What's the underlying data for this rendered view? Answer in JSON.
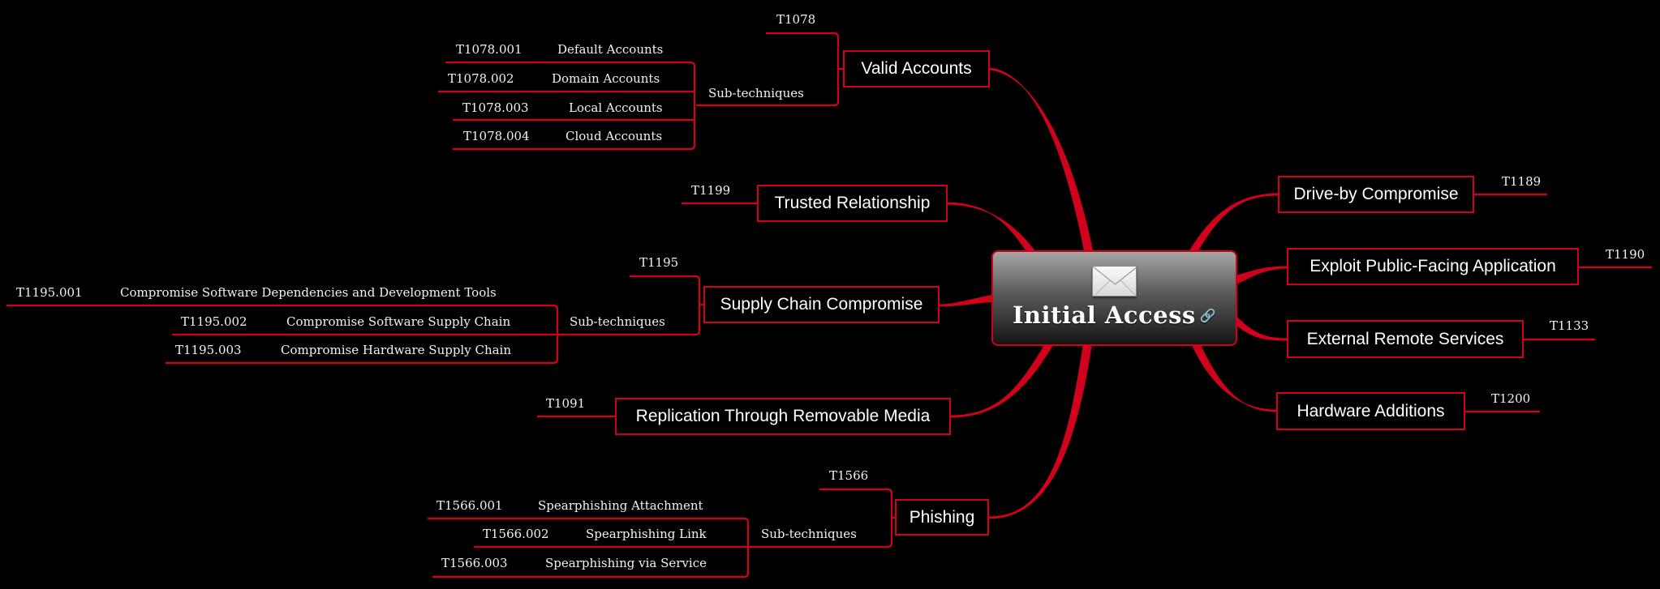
{
  "central": {
    "title": "Initial Access",
    "icon": "envelope-icon",
    "link_icon": "link-icon"
  },
  "colors": {
    "accent": "#d0021b",
    "background": "#000000",
    "link": "#2d7be0"
  },
  "techniques": [
    {
      "name": "Valid Accounts",
      "id": "T1078",
      "side": "left",
      "subtechniques_label": "Sub-techniques",
      "subtechniques": [
        {
          "id": "T1078.001",
          "name": "Default Accounts"
        },
        {
          "id": "T1078.002",
          "name": "Domain Accounts"
        },
        {
          "id": "T1078.003",
          "name": "Local Accounts"
        },
        {
          "id": "T1078.004",
          "name": "Cloud Accounts"
        }
      ]
    },
    {
      "name": "Trusted Relationship",
      "id": "T1199",
      "side": "left"
    },
    {
      "name": "Supply Chain Compromise",
      "id": "T1195",
      "side": "left",
      "subtechniques_label": "Sub-techniques",
      "subtechniques": [
        {
          "id": "T1195.001",
          "name": "Compromise Software Dependencies and Development Tools"
        },
        {
          "id": "T1195.002",
          "name": "Compromise Software Supply Chain"
        },
        {
          "id": "T1195.003",
          "name": "Compromise Hardware Supply Chain"
        }
      ]
    },
    {
      "name": "Replication Through Removable Media",
      "id": "T1091",
      "side": "left"
    },
    {
      "name": "Phishing",
      "id": "T1566",
      "side": "left",
      "subtechniques_label": "Sub-techniques",
      "subtechniques": [
        {
          "id": "T1566.001",
          "name": "Spearphishing Attachment"
        },
        {
          "id": "T1566.002",
          "name": "Spearphishing Link"
        },
        {
          "id": "T1566.003",
          "name": "Spearphishing via Service"
        }
      ]
    },
    {
      "name": "Drive-by Compromise",
      "id": "T1189",
      "side": "right"
    },
    {
      "name": "Exploit Public-Facing Application",
      "id": "T1190",
      "side": "right"
    },
    {
      "name": "External Remote Services",
      "id": "T1133",
      "side": "right"
    },
    {
      "name": "Hardware Additions",
      "id": "T1200",
      "side": "right"
    }
  ]
}
